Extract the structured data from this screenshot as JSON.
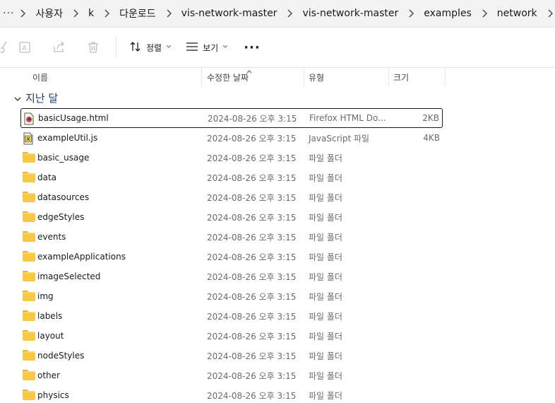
{
  "breadcrumb": {
    "more": "···",
    "items": [
      "사용자",
      "k",
      "다운로드",
      "vis-network-master",
      "vis-network-master",
      "examples",
      "network"
    ]
  },
  "toolbar": {
    "sort_label": "정렬",
    "view_label": "보기",
    "more": "···",
    "icons": [
      "cut-icon",
      "rename-icon",
      "share-icon",
      "delete-icon"
    ]
  },
  "columns": {
    "name": "이름",
    "date": "수정한 날짜",
    "type": "유형",
    "size": "크기"
  },
  "group": {
    "label": "지난 달"
  },
  "files": [
    {
      "name": "basicUsage.html",
      "date": "2024-08-26 오후 3:15",
      "type": "Firefox HTML Do...",
      "size": "2KB",
      "icon": "html-file-icon"
    },
    {
      "name": "exampleUtil.js",
      "date": "2024-08-26 오후 3:15",
      "type": "JavaScript 파일",
      "size": "4KB",
      "icon": "js-file-icon"
    },
    {
      "name": "basic_usage",
      "date": "2024-08-26 오후 3:15",
      "type": "파일 폴더",
      "size": "",
      "icon": "folder-icon"
    },
    {
      "name": "data",
      "date": "2024-08-26 오후 3:15",
      "type": "파일 폴더",
      "size": "",
      "icon": "folder-icon"
    },
    {
      "name": "datasources",
      "date": "2024-08-26 오후 3:15",
      "type": "파일 폴더",
      "size": "",
      "icon": "folder-icon"
    },
    {
      "name": "edgeStyles",
      "date": "2024-08-26 오후 3:15",
      "type": "파일 폴더",
      "size": "",
      "icon": "folder-icon"
    },
    {
      "name": "events",
      "date": "2024-08-26 오후 3:15",
      "type": "파일 폴더",
      "size": "",
      "icon": "folder-icon"
    },
    {
      "name": "exampleApplications",
      "date": "2024-08-26 오후 3:15",
      "type": "파일 폴더",
      "size": "",
      "icon": "folder-icon"
    },
    {
      "name": "imageSelected",
      "date": "2024-08-26 오후 3:15",
      "type": "파일 폴더",
      "size": "",
      "icon": "folder-icon"
    },
    {
      "name": "img",
      "date": "2024-08-26 오후 3:15",
      "type": "파일 폴더",
      "size": "",
      "icon": "folder-icon"
    },
    {
      "name": "labels",
      "date": "2024-08-26 오후 3:15",
      "type": "파일 폴더",
      "size": "",
      "icon": "folder-icon"
    },
    {
      "name": "layout",
      "date": "2024-08-26 오후 3:15",
      "type": "파일 폴더",
      "size": "",
      "icon": "folder-icon"
    },
    {
      "name": "nodeStyles",
      "date": "2024-08-26 오후 3:15",
      "type": "파일 폴더",
      "size": "",
      "icon": "folder-icon"
    },
    {
      "name": "other",
      "date": "2024-08-26 오후 3:15",
      "type": "파일 폴더",
      "size": "",
      "icon": "folder-icon"
    },
    {
      "name": "physics",
      "date": "2024-08-26 오후 3:15",
      "type": "파일 폴더",
      "size": "",
      "icon": "folder-icon"
    }
  ],
  "colors": {
    "folder": "#f7c843",
    "group_text": "#1a3e6e",
    "secondary_text": "#6b6b6b"
  }
}
